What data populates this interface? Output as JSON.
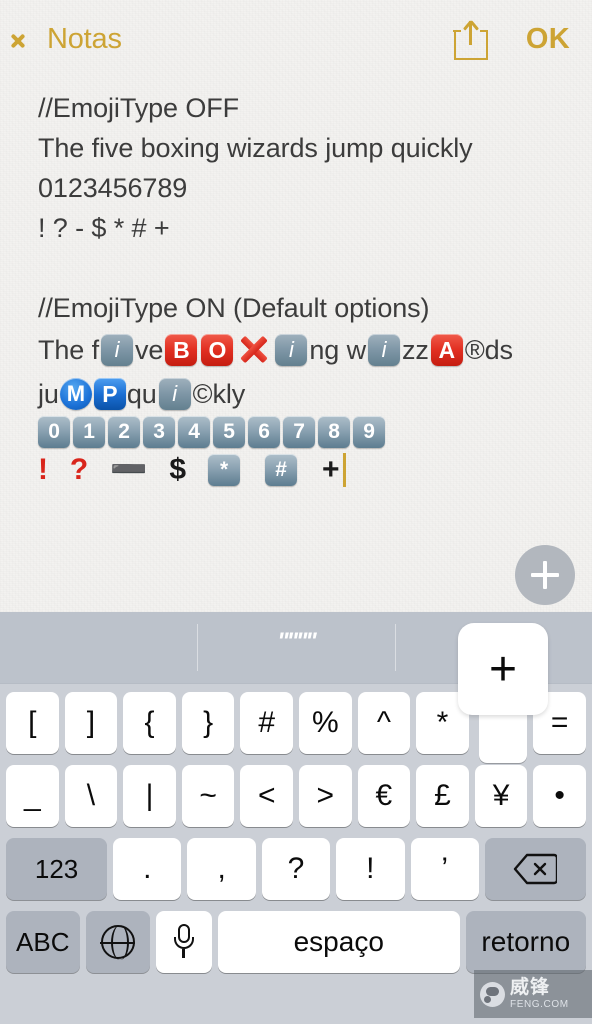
{
  "navbar": {
    "back_label": "Notas",
    "back_icon": "chevron-left-icon",
    "share_icon": "share-icon",
    "done_label": "OK",
    "accent_color": "#cda434"
  },
  "note": {
    "section_off": {
      "header": "//EmojiType OFF",
      "pangram": "The five boxing wizards jump quickly",
      "digits": "0123456789",
      "symbols": "! ? - $ * # +"
    },
    "section_on": {
      "header": "//EmojiType ON (Default options)",
      "line1": [
        {
          "kind": "text",
          "value": "The f"
        },
        {
          "kind": "emoji",
          "glyph": "i",
          "style": "info-keycap",
          "name": "information-emoji"
        },
        {
          "kind": "text",
          "value": "ve "
        },
        {
          "kind": "emoji",
          "glyph": "B",
          "style": "red-square",
          "name": "b-button-emoji"
        },
        {
          "kind": "emoji",
          "glyph": "O",
          "style": "red-square",
          "name": "o-button-emoji"
        },
        {
          "kind": "emoji",
          "glyph": "X",
          "style": "cross-mark",
          "name": "cross-mark-emoji"
        },
        {
          "kind": "emoji",
          "glyph": "i",
          "style": "info-keycap",
          "name": "information-emoji"
        },
        {
          "kind": "text",
          "value": "ng w"
        },
        {
          "kind": "emoji",
          "glyph": "i",
          "style": "info-keycap",
          "name": "information-emoji"
        },
        {
          "kind": "text",
          "value": "zz"
        },
        {
          "kind": "emoji",
          "glyph": "A",
          "style": "red-square",
          "name": "a-button-emoji"
        },
        {
          "kind": "text",
          "value": "®ds"
        }
      ],
      "line2": [
        {
          "kind": "text",
          "value": "ju"
        },
        {
          "kind": "emoji",
          "glyph": "M",
          "style": "blue-circle",
          "name": "circled-m-emoji"
        },
        {
          "kind": "emoji",
          "glyph": "P",
          "style": "blue-square",
          "name": "p-button-emoji"
        },
        {
          "kind": "text",
          "value": " qu"
        },
        {
          "kind": "emoji",
          "glyph": "i",
          "style": "info-keycap",
          "name": "information-emoji"
        },
        {
          "kind": "text",
          "value": "©kly"
        }
      ],
      "digit_keycaps": [
        "0",
        "1",
        "2",
        "3",
        "4",
        "5",
        "6",
        "7",
        "8",
        "9"
      ],
      "symbol_row": [
        {
          "glyph": "❗",
          "display": "!",
          "style": "red-punct",
          "name": "exclamation-mark-emoji"
        },
        {
          "glyph": "❓",
          "display": "?",
          "style": "red-punct",
          "name": "question-mark-emoji"
        },
        {
          "glyph": "➖",
          "display": "➖",
          "style": "black-punct",
          "name": "minus-sign-emoji"
        },
        {
          "glyph": "💲",
          "display": "$",
          "style": "black-punct",
          "name": "dollar-sign-emoji"
        },
        {
          "glyph": "✳",
          "display": "*",
          "style": "keycap",
          "name": "asterisk-emoji"
        },
        {
          "glyph": "#️⃣",
          "display": "#",
          "style": "keycap",
          "name": "hash-keycap-emoji"
        },
        {
          "glyph": "➕",
          "display": "+",
          "style": "black-punct",
          "name": "plus-sign-emoji"
        }
      ],
      "cursor_visible": true
    }
  },
  "fab": {
    "icon": "plus-icon",
    "color": "#b2b7be"
  },
  "keyboard": {
    "predictive": [
      "",
      "\"\"\"\"",
      "",
      ""
    ],
    "popup": {
      "label": "+",
      "over_key": "plus-key"
    },
    "row1": [
      "[",
      "]",
      "{",
      "}",
      "#",
      "%",
      "^",
      "*",
      "+",
      "="
    ],
    "row2": [
      "_",
      "\\",
      "|",
      "~",
      "<",
      ">",
      "€",
      "£",
      "¥",
      "•"
    ],
    "row3": {
      "numeric_label": "123",
      "keys": [
        ".",
        ",",
        "?",
        "!",
        "’"
      ],
      "delete_icon": "delete-backward-icon"
    },
    "row4": {
      "abc_label": "ABC",
      "globe_icon": "globe-icon",
      "mic_icon": "microphone-icon",
      "space_label": "espaço",
      "return_label": "retorno"
    }
  },
  "watermark": {
    "cn": "威锋",
    "en": "FENG.COM"
  }
}
